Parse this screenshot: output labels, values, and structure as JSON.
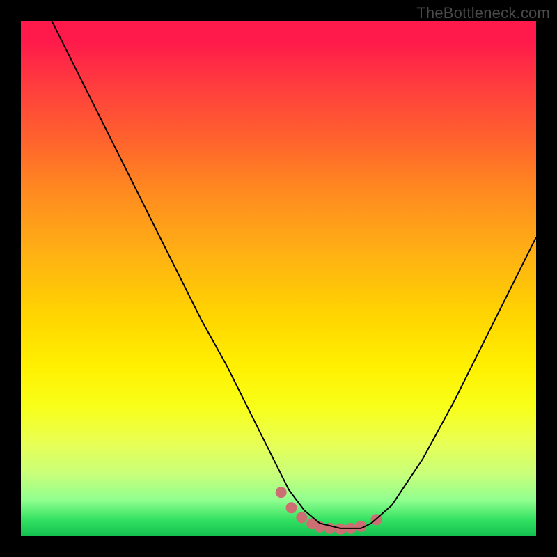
{
  "watermark": "TheBottleneck.com",
  "chart_data": {
    "type": "line",
    "title": "",
    "xlabel": "",
    "ylabel": "",
    "xlim": [
      0,
      100
    ],
    "ylim": [
      0,
      100
    ],
    "series": [
      {
        "name": "curve",
        "x": [
          6,
          10,
          15,
          20,
          25,
          30,
          35,
          40,
          45,
          50,
          52,
          55,
          58,
          62,
          66,
          68,
          72,
          78,
          84,
          90,
          96,
          100
        ],
        "y": [
          100,
          92,
          82,
          72,
          62,
          52,
          42,
          33,
          23,
          13,
          9,
          5,
          2.5,
          1.5,
          1.5,
          2.5,
          6,
          15,
          26,
          38,
          50,
          58
        ],
        "stroke": "#000000",
        "stroke_width": 2
      }
    ],
    "markers": {
      "name": "bottom-dots",
      "color": "#cc6f72",
      "points_x": [
        50.5,
        52.5,
        54.5,
        56.5,
        58,
        60,
        62,
        64,
        66,
        69
      ],
      "points_y": [
        8.5,
        5.5,
        3.6,
        2.4,
        1.8,
        1.5,
        1.4,
        1.5,
        1.9,
        3.2
      ],
      "radius": 8
    },
    "background_gradient": {
      "top": "#ff1a4b",
      "mid": "#ffe000",
      "bottom": "#14c050"
    }
  }
}
